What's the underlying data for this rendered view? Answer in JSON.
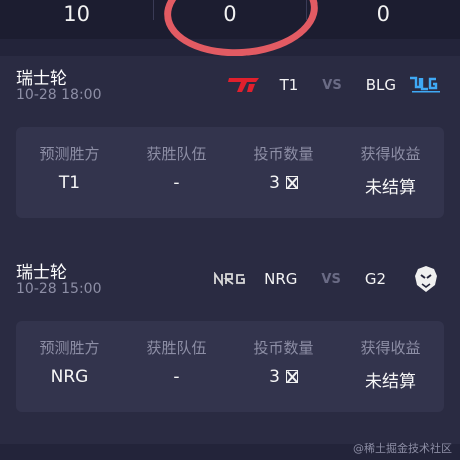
{
  "stats": [
    "10",
    "0",
    "0"
  ],
  "matches": [
    {
      "title": "瑞士轮",
      "time": "10-28 18:00",
      "team_left": "T1",
      "team_right": "BLG",
      "vs": "VS",
      "left_logo": "t1-logo",
      "right_logo": "blg-logo",
      "columns": [
        {
          "header": "预测胜方",
          "value": "T1"
        },
        {
          "header": "获胜队伍",
          "value": "-"
        },
        {
          "header": "投币数量",
          "value": "3"
        },
        {
          "header": "获得收益",
          "value": "未结算"
        }
      ]
    },
    {
      "title": "瑞士轮",
      "time": "10-28 15:00",
      "team_left": "NRG",
      "team_right": "G2",
      "vs": "VS",
      "left_logo": "nrg-logo",
      "right_logo": "g2-logo",
      "columns": [
        {
          "header": "预测胜方",
          "value": "NRG"
        },
        {
          "header": "获胜队伍",
          "value": "-"
        },
        {
          "header": "投币数量",
          "value": "3"
        },
        {
          "header": "获得收益",
          "value": "未结算"
        }
      ]
    }
  ],
  "watermark": "@稀土掘金技术社区",
  "colors": {
    "annotation": "#e25b63",
    "t1_red": "#e0202d",
    "blg_blue": "#3fa9f5"
  }
}
